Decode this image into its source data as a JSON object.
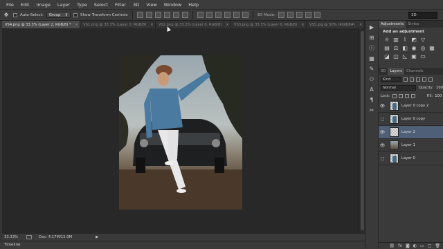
{
  "menu": [
    "File",
    "Edit",
    "Image",
    "Layer",
    "Type",
    "Select",
    "Filter",
    "3D",
    "View",
    "Window",
    "Help"
  ],
  "options": {
    "auto_select_label": "Auto-Select:",
    "auto_select_value": "Group",
    "transform_label": "Show Transform Controls",
    "mode_label": "3D Mode:",
    "workspace": "3D"
  },
  "tabs": [
    {
      "label": "VS4.png @ 33.3% (Layer 2, RGB/8) *",
      "active": true
    },
    {
      "label": "VS1.png @ 33.3% (Layer 0, RGB/8)",
      "active": false
    },
    {
      "label": "VS2.png @ 33.3% (Layer 0, RGB/8)",
      "active": false
    },
    {
      "label": "VS3.png @ 33.3% (Layer 0, RGB/8)",
      "active": false
    },
    {
      "label": "VS5.jpg @ 50% (RGB/8#)",
      "active": false
    }
  ],
  "status": {
    "zoom": "33.33%",
    "doc": "Doc: 4.17M/15.0M"
  },
  "timeline_label": "Timeline",
  "adjustments": {
    "tab_active": "Adjustments",
    "tab_other": "Styles",
    "title": "Add an adjustment"
  },
  "layers_panel": {
    "tabs": [
      "3D",
      "Layers",
      "Channels"
    ],
    "kind": "Kind",
    "blend_mode": "Normal",
    "opacity_label": "Opacity:",
    "opacity_value": "100",
    "lock_label": "Lock:",
    "fill_label": "Fill:",
    "fill_value": "100",
    "layers": [
      {
        "name": "Layer 0 copy 2",
        "visible": true,
        "selected": false,
        "thumb": "figure"
      },
      {
        "name": "Layer 0 copy",
        "visible": false,
        "selected": false,
        "thumb": "figure"
      },
      {
        "name": "Layer 2",
        "visible": true,
        "selected": true,
        "thumb": "empty"
      },
      {
        "name": "Layer 1",
        "visible": true,
        "selected": false,
        "thumb": "photo"
      },
      {
        "name": "Layer 0",
        "visible": false,
        "selected": false,
        "thumb": "figure"
      }
    ]
  }
}
